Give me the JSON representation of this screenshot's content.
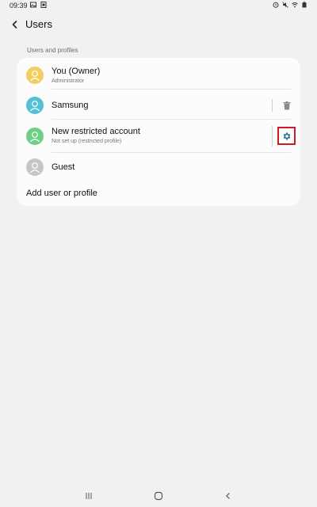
{
  "status_bar": {
    "time": "09:39",
    "left_icons": [
      "gallery-icon",
      "screenshot-icon"
    ],
    "right_icons": [
      "alarm-icon",
      "mute-icon",
      "wifi-icon",
      "battery-icon"
    ]
  },
  "header": {
    "title": "Users",
    "back_icon": "chevron-left-icon"
  },
  "section": {
    "header": "Users and profiles"
  },
  "users": [
    {
      "name": "You (Owner)",
      "subtitle": "Administrator",
      "avatar_color": "#f0cf62"
    },
    {
      "name": "Samsung",
      "subtitle": "",
      "avatar_color": "#53c0d6",
      "action_icon": "trash-icon"
    },
    {
      "name": "New restricted account",
      "subtitle": "Not set up (restricted profile)",
      "avatar_color": "#6fce86",
      "action_icon": "gear-icon"
    },
    {
      "name": "Guest",
      "subtitle": "",
      "avatar_color": "#c6c6c6"
    }
  ],
  "add_user": {
    "label": "Add user or profile"
  },
  "nav_bar": {
    "icons": [
      "recents-icon",
      "home-icon",
      "back-icon"
    ]
  },
  "colors": {
    "background": "#f1f1f1",
    "card": "#fcfcfc",
    "accent": "#1b7a86",
    "highlight": "#d0192b"
  }
}
